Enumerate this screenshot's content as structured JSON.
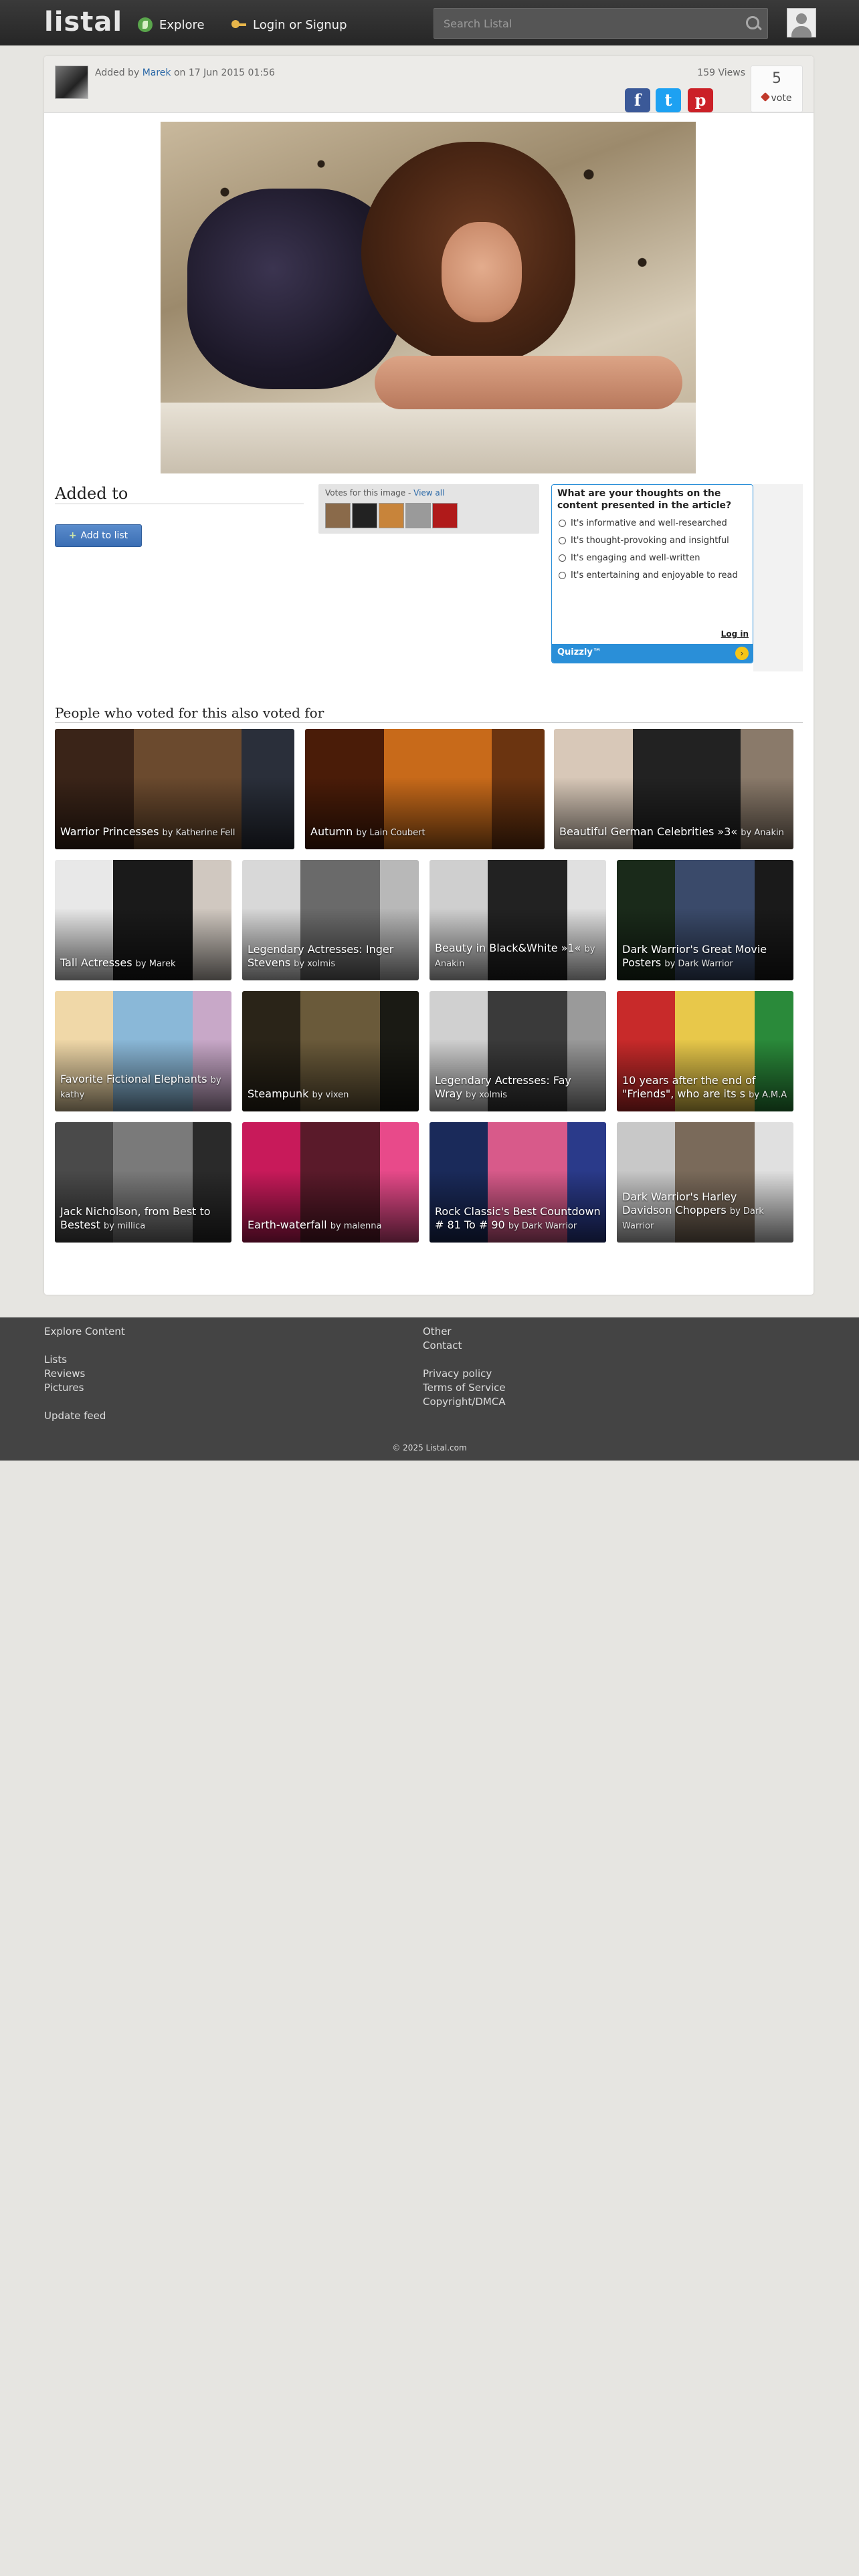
{
  "header": {
    "logo": "listal",
    "explore": "Explore",
    "login": "Login or Signup",
    "search_placeholder": "Search Listal"
  },
  "image_meta": {
    "added_by_prefix": "Added by",
    "user": "Marek",
    "date_text": "on 17 Jun 2015 01:56",
    "views": "159 Views",
    "vote_count": "5",
    "vote_label": "vote"
  },
  "added_to": {
    "title": "Added to",
    "add_button": "Add to list"
  },
  "votes": {
    "title": "Votes for this image - ",
    "view_all": "View all",
    "voter_colors": [
      "#8a6a4a",
      "#222222",
      "#c8843a",
      "#9a9a9a",
      "#b01a1a"
    ]
  },
  "quiz": {
    "question": "What are your thoughts on the content presented in the article?",
    "options": [
      "It's informative and well-researched",
      "It's thought-provoking and insightful",
      "It's engaging and well-written",
      "It's entertaining and enjoyable to read"
    ],
    "login": "Log in",
    "brand": "Quizzly™"
  },
  "also_voted": {
    "title": "People who voted for this also voted for",
    "lists": [
      {
        "title": "Warrior Princesses",
        "by": "by Katherine Fell",
        "colors": [
          "#3a2418",
          "#6b4a2e",
          "#2a2f3a"
        ]
      },
      {
        "title": "Autumn",
        "by": "by Lain Coubert",
        "colors": [
          "#4a1c08",
          "#c86a1a",
          "#6b3410"
        ]
      },
      {
        "title": "Beautiful German Celebrities »3«",
        "by": "by Anakin",
        "colors": [
          "#d8c8b8",
          "#222222",
          "#8a7a6a"
        ]
      },
      {
        "title": "Tall Actresses",
        "by": "by Marek",
        "colors": [
          "#e8e8e8",
          "#1a1a1a",
          "#d0c8c0"
        ]
      },
      {
        "title": "Legendary Actresses: Inger Stevens",
        "by": "by xolmis",
        "colors": [
          "#d8d8d8",
          "#6a6a6a",
          "#b8b8b8"
        ]
      },
      {
        "title": "Beauty in Black&White »1«",
        "by": "by Anakin",
        "colors": [
          "#cfcfcf",
          "#222222",
          "#e0e0e0"
        ]
      },
      {
        "title": "Dark Warrior's Great Movie Posters",
        "by": "by Dark Warrior",
        "colors": [
          "#1a2a1a",
          "#3a4a6a",
          "#1a1a1a"
        ]
      },
      {
        "title": "Favorite Fictional Elephants",
        "by": "by kathy",
        "colors": [
          "#f0d8a8",
          "#8ab8d8",
          "#c8a8c8"
        ]
      },
      {
        "title": "Steampunk",
        "by": "by vixen",
        "colors": [
          "#2a2418",
          "#6a5a3a",
          "#1a1a14"
        ]
      },
      {
        "title": "Legendary Actresses: Fay Wray",
        "by": "by xolmis",
        "colors": [
          "#d0d0d0",
          "#3a3a3a",
          "#9a9a9a"
        ]
      },
      {
        "title": "10 years after the end of \"Friends\", who are its s",
        "by": "by A.M.A",
        "colors": [
          "#c82a2a",
          "#e8c84a",
          "#2a8a3a"
        ]
      },
      {
        "title": "Jack Nicholson, from Best to Bestest",
        "by": "by millica",
        "colors": [
          "#4a4a4a",
          "#7a7a7a",
          "#2a2a2a"
        ]
      },
      {
        "title": "Earth-waterfall",
        "by": "by malenna",
        "colors": [
          "#c81a5a",
          "#5a1a2a",
          "#e84a8a"
        ]
      },
      {
        "title": "Rock Classic's Best Countdown # 81 To # 90",
        "by": "by Dark Warrior",
        "colors": [
          "#1a2a5a",
          "#d85a8a",
          "#2a3a8a"
        ]
      },
      {
        "title": "Dark Warrior's Harley Davidson Choppers",
        "by": "by Dark Warrior",
        "colors": [
          "#c8c8c8",
          "#7a6a5a",
          "#e0e0e0"
        ]
      }
    ]
  },
  "footer": {
    "explore_content": "Explore Content",
    "lists": "Lists",
    "reviews": "Reviews",
    "pictures": "Pictures",
    "update_feed": "Update feed",
    "other": "Other",
    "contact": "Contact",
    "privacy": "Privacy policy",
    "terms": "Terms of Service",
    "copyright": "Copyright/DMCA",
    "copy": "© 2025 Listal.com"
  }
}
